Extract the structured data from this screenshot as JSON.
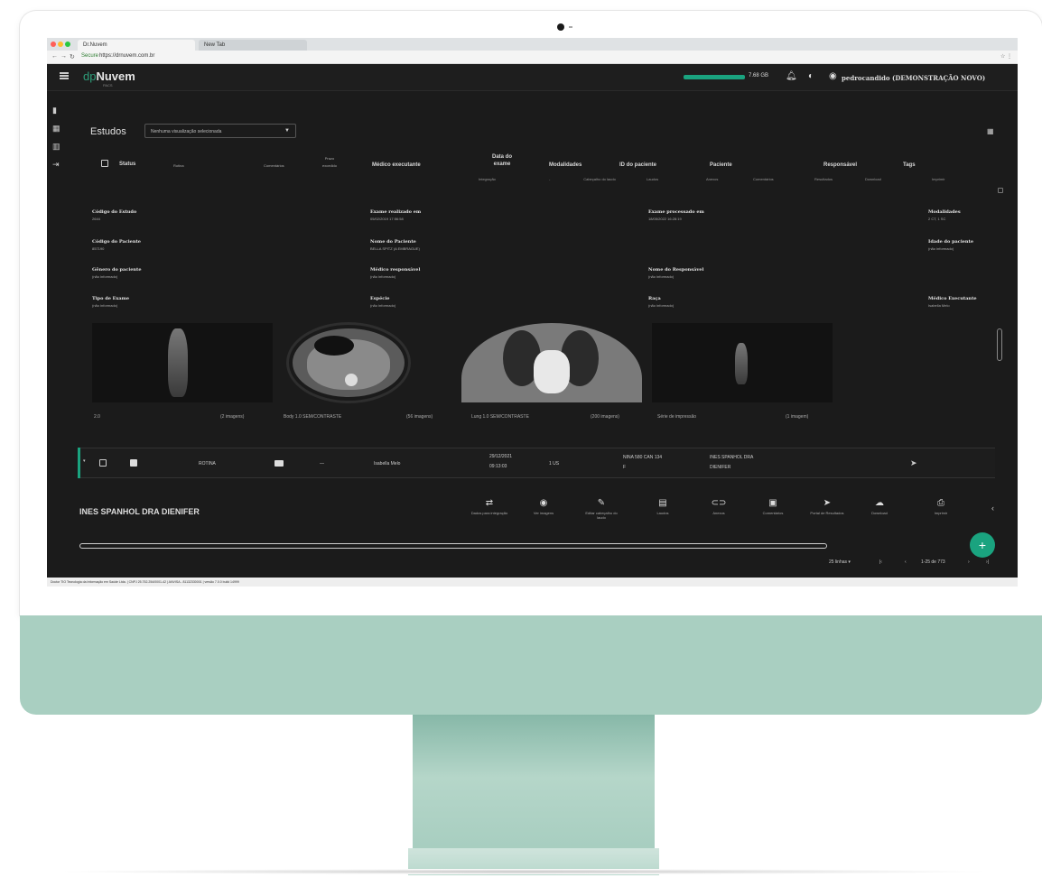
{
  "browser": {
    "tabs": [
      "Dr.Nuvem",
      "New Tab"
    ],
    "secure_label": "Secure",
    "url": "https://drnuvem.com.br"
  },
  "header": {
    "logo_prefix": "dp",
    "logo_main": "Nuvem",
    "logo_sub": "PACS",
    "quota_text": "7.68 GB",
    "user": "pedrocandido (DEMONSTRAÇÃO NOVO)"
  },
  "toolbar": {
    "title": "Estudos",
    "view_select": "Nenhuma visualização selecionada"
  },
  "table": {
    "headers": {
      "status": "Status",
      "rotina": "Rotina",
      "comentarios": "Comentários",
      "prazo": "Prazo excedido",
      "medico": "Médico executante",
      "data": "Data do exame",
      "modalidades": "Modalidades",
      "id_paciente": "ID do paciente",
      "paciente": "Paciente",
      "responsavel": "Responsável",
      "tags": "Tags"
    },
    "subheaders": [
      "Integração",
      "-",
      "Cabeçalho do laudo",
      "Laudos",
      "Anexos",
      "Comentários",
      "Resultados",
      "Download",
      "Imprimir"
    ]
  },
  "details": {
    "codigo_estudo": {
      "label": "Código do Estudo",
      "value": "2644"
    },
    "exame_realizado": {
      "label": "Exame realizado em",
      "value": "05/02/2019 17:56:58"
    },
    "exame_processado": {
      "label": "Exame processado em",
      "value": "18/05/2022 16:28:19"
    },
    "modalidades": {
      "label": "Modalidades",
      "value": "2 CT, 1 SC"
    },
    "codigo_paciente": {
      "label": "Código do Paciente",
      "value": "857190"
    },
    "nome_paciente": {
      "label": "Nome do Paciente",
      "value": "BELLA SPITZ (A EMBRAGUE)"
    },
    "idade_paciente": {
      "label": "Idade do paciente",
      "value": "(não informado)"
    },
    "genero": {
      "label": "Gênero do paciente",
      "value": "(não informado)"
    },
    "medico_responsavel": {
      "label": "Médico responsável",
      "value": "(não informado)"
    },
    "nome_responsavel": {
      "label": "Nome do Responsável",
      "value": "(não informado)"
    },
    "tipo_exame": {
      "label": "Tipo de Exame",
      "value": "(não informado)"
    },
    "especie": {
      "label": "Espécie",
      "value": "(não informado)"
    },
    "raca": {
      "label": "Raça",
      "value": "(não informado)"
    },
    "medico_executante": {
      "label": "Médico Executante",
      "value": "Isabella Melo"
    }
  },
  "series": [
    {
      "name": "2.0",
      "count": "(2 imagens)"
    },
    {
      "name": "Body 1.0 SEM/CONTRASTE",
      "count": "(56 imagens)"
    },
    {
      "name": "Lung 1.0 SEM/CONTRASTE",
      "count": "(200 imagens)"
    },
    {
      "name": "Série de impressão",
      "count": "(1 imagem)"
    }
  ],
  "row": {
    "rotina": "ROTINA",
    "dash": "—",
    "medico": "Isabella Melo",
    "data": "29/12/2021",
    "hora": "09:13:03",
    "modalidade": "1 US",
    "id_paciente_1": "NINA 580 CAN 134",
    "id_paciente_2": "F",
    "paciente_1": "INES SPANHOL DRA",
    "paciente_2": "DIENIFER"
  },
  "actions": {
    "patient": "INES SPANHOL DRA DIENIFER",
    "items": [
      {
        "icon": "⇄",
        "label": "Dados para integração"
      },
      {
        "icon": "◉",
        "label": "Ver imagens"
      },
      {
        "icon": "✎",
        "label": "Editar cabeçalho do laudo"
      },
      {
        "icon": "▤",
        "label": "Laudos"
      },
      {
        "icon": "⊂⊃",
        "label": "Anexos"
      },
      {
        "icon": "▣",
        "label": "Comentários"
      },
      {
        "icon": "➤",
        "label": "Portal de Resultados"
      },
      {
        "icon": "☁",
        "label": "Download"
      },
      {
        "icon": "⎙",
        "label": "Imprimir"
      }
    ]
  },
  "pagination": {
    "per_page": "25 linhas",
    "range": "1-25 de 773"
  },
  "footer": "Doctor TIO Tecnologia da Informação em Saúde Ltda. | CNPJ 25.752.254/0001-42 | ANVISA - 81132330001 | versão 7.0.0 build 14999"
}
